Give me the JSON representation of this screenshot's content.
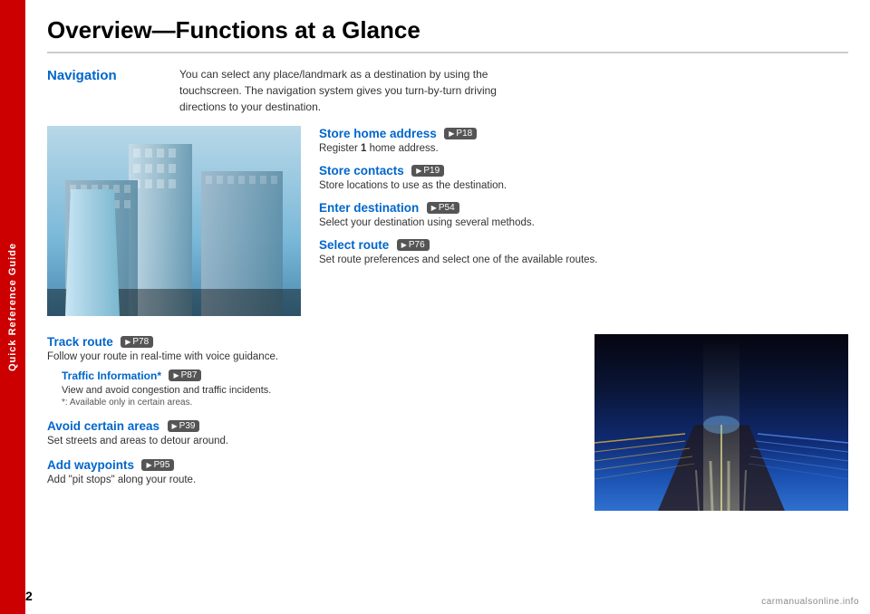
{
  "sidebar": {
    "label": "Quick Reference Guide"
  },
  "page": {
    "title": "Overview—Functions at a Glance",
    "number": "2",
    "watermark": "carmanualsonline.info"
  },
  "navigation": {
    "label": "Navigation",
    "description": "You can select any place/landmark as a destination by using the touchscreen. The navigation system gives you turn-by-turn driving directions to your destination."
  },
  "features_upper": [
    {
      "title": "Store home address",
      "page_ref": "P18",
      "description": "Register 1 home address."
    },
    {
      "title": "Store contacts",
      "page_ref": "P19",
      "description": "Store locations to use as the destination."
    },
    {
      "title": "Enter destination",
      "page_ref": "P54",
      "description": "Select your destination using several methods."
    },
    {
      "title": "Select route",
      "page_ref": "P76",
      "description": "Set route preferences and select one of the available routes."
    }
  ],
  "features_lower": [
    {
      "title": "Track route",
      "page_ref": "P78",
      "description": "Follow your route in real-time with voice guidance.",
      "sub_feature": {
        "title": "Traffic Information*",
        "page_ref": "P87",
        "description": "View and avoid congestion and traffic incidents.",
        "note": "*: Available only in certain areas."
      }
    },
    {
      "title": "Avoid certain areas",
      "page_ref": "P39",
      "description": "Set streets and areas to detour around."
    },
    {
      "title": "Add waypoints",
      "page_ref": "P95",
      "description": "Add \"pit stops\" along your route."
    }
  ]
}
